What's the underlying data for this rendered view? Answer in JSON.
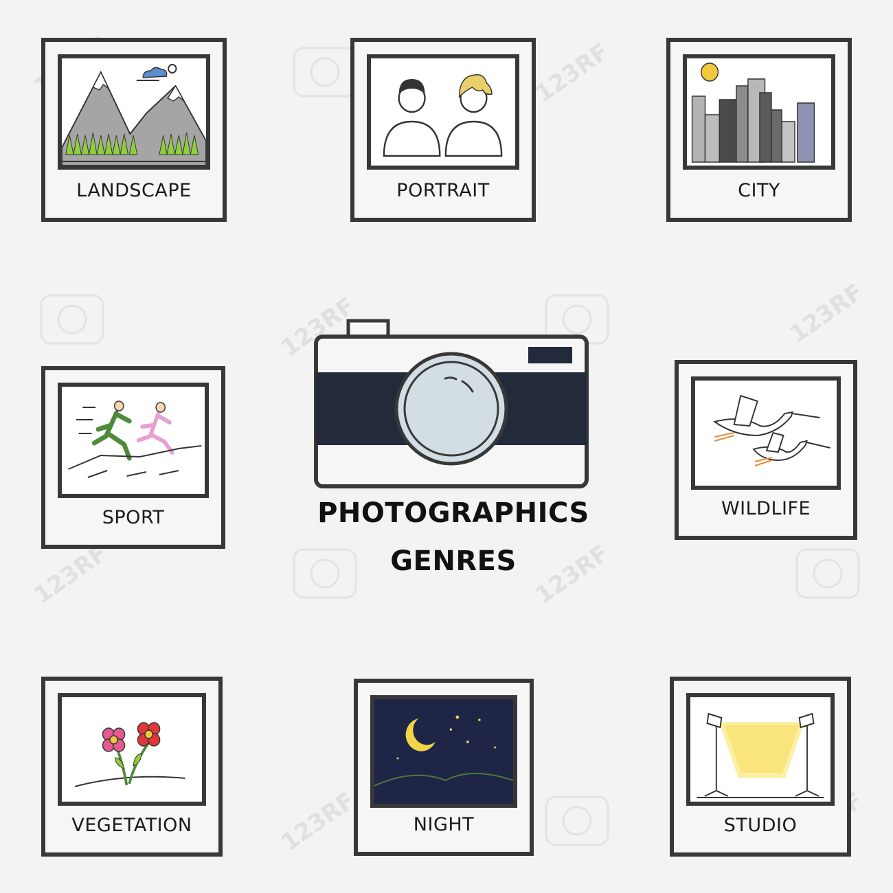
{
  "title": {
    "line1": "PHOTOGRAPHICS",
    "line2": "GENRES"
  },
  "watermark": {
    "text": "123RF"
  },
  "genres": [
    {
      "id": "landscape",
      "label": "LANDSCAPE"
    },
    {
      "id": "portrait",
      "label": "PORTRAIT"
    },
    {
      "id": "city",
      "label": "CITY"
    },
    {
      "id": "sport",
      "label": "SPORT"
    },
    {
      "id": "wildlife",
      "label": "WILDLIFE"
    },
    {
      "id": "vegetation",
      "label": "VEGETATION"
    },
    {
      "id": "night",
      "label": "NIGHT"
    },
    {
      "id": "studio",
      "label": "STUDIO"
    }
  ],
  "colors": {
    "frame": "#383838",
    "background": "#f3f3f3",
    "camera_band": "#232a3a",
    "camera_lens": "#d3dde4",
    "night_sky": "#1f2546",
    "star": "#f0d44a"
  }
}
